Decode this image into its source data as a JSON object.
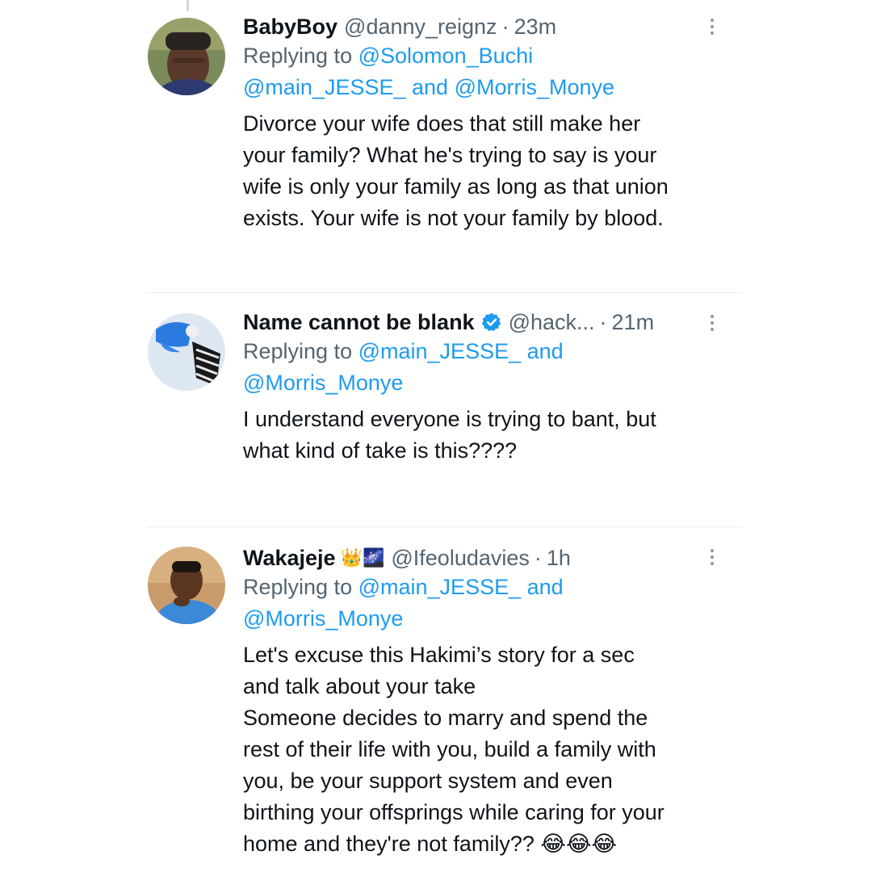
{
  "replies": [
    {
      "name": "BabyBoy",
      "handle": "@danny_reignz",
      "dot": "·",
      "time": "23m",
      "replying_prefix": "Replying to",
      "replying_line1": "@Solomon_Buchi",
      "replying_line2_a": "@main_JESSE_",
      "replying_line2_and": "and",
      "replying_line2_b": "@Morris_Monye",
      "text_lines": [
        "Divorce your wife does that still make her",
        "your family? What he's trying to say is your",
        "wife is only your family as long as that union",
        "exists. Your wife is not your family by blood."
      ]
    },
    {
      "name": "Name cannot be blank",
      "handle": "@hack...",
      "dot": "·",
      "time": "21m",
      "replying_prefix": "Replying to",
      "replying_line1_a": "@main_JESSE_",
      "replying_line1_and": "and",
      "replying_line2": "@Morris_Monye",
      "text_lines": [
        "I understand everyone is trying to bant, but",
        "what kind of take is this????"
      ]
    },
    {
      "name": "Wakajeje",
      "name_emoji": "👑🌌",
      "handle": "@Ifeoludavies",
      "dot": "·",
      "time": "1h",
      "replying_prefix": "Replying to",
      "replying_line1_a": "@main_JESSE_",
      "replying_line1_and": "and",
      "replying_line2": "@Morris_Monye",
      "text_lines": [
        "Let's excuse this Hakimi’s story for a sec",
        "and talk about your take",
        "Someone decides to marry and spend the",
        "rest of their life with you, build a family with",
        "you, be your support system and even",
        "birthing your offsprings while caring for your",
        "home and they're not family??"
      ],
      "trailing_emoji": "😂😂😂"
    }
  ],
  "icons": {
    "verified": "verified-badge-icon",
    "more": "more-options-icon",
    "verified_color": "#1d9bf0",
    "link_color": "#1d9bf0"
  }
}
